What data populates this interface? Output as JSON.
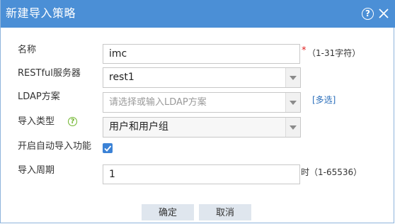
{
  "dialog": {
    "title": "新建导入策略",
    "help_glyph": "?",
    "close_label": "×"
  },
  "form": {
    "name": {
      "label": "名称",
      "value": "imc",
      "required_mark": "*",
      "hint": "（1-31字符）"
    },
    "rest_server": {
      "label": "RESTful服务器",
      "value": "rest1"
    },
    "ldap_scheme": {
      "label": "LDAP方案",
      "placeholder": "请选择或输入LDAP方案",
      "link": "[多选]"
    },
    "import_type": {
      "label": "导入类型",
      "value": "用户和用户组",
      "help_glyph": "?"
    },
    "auto_import": {
      "label": "开启自动导入功能",
      "checked": true
    },
    "import_period": {
      "label": "导入周期",
      "value": "1",
      "hint": "时（1-65536）"
    }
  },
  "buttons": {
    "ok": "确定",
    "cancel": "取消"
  },
  "colors": {
    "titlebar": "#4b8fd6",
    "required": "#e02020",
    "link": "#2a6ebb",
    "checkbox": "#3b82d6",
    "help_green": "#6fb52c",
    "button_bg": "#dfe6ee"
  }
}
